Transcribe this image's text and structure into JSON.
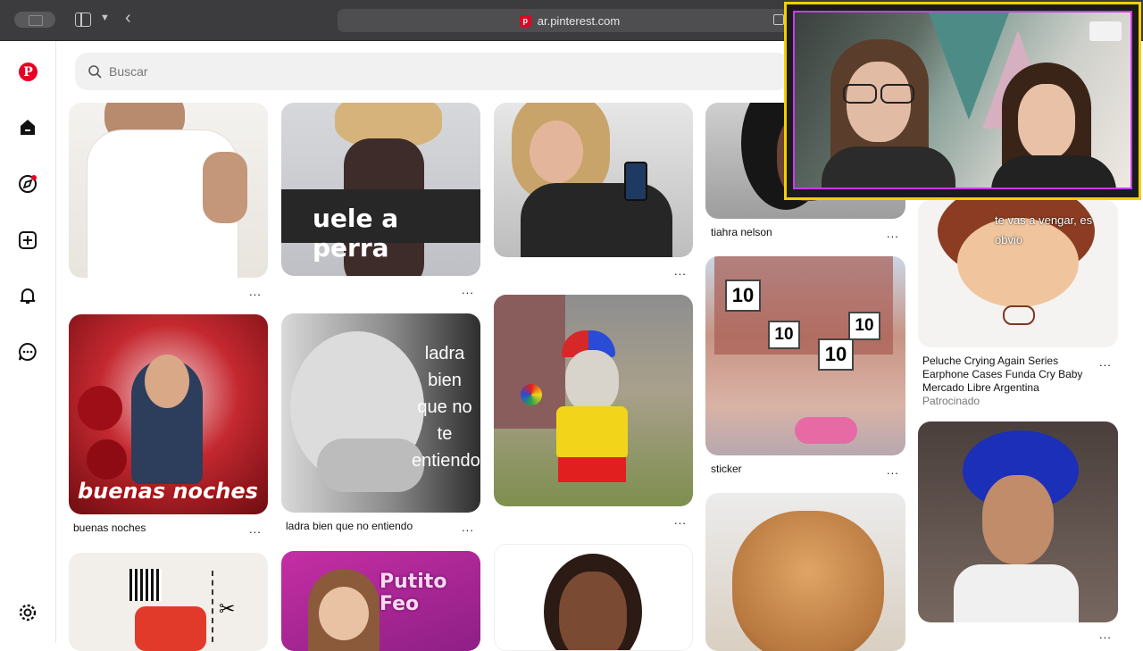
{
  "browser": {
    "url": "ar.pinterest.com",
    "favicon_letter": "p"
  },
  "sidebar": {
    "logo_letter": "P",
    "icons": [
      "home-icon",
      "explore-icon",
      "create-icon",
      "notifications-icon",
      "messages-icon",
      "settings-icon"
    ]
  },
  "search": {
    "placeholder": "Buscar"
  },
  "pins": [
    {
      "caption": "",
      "label": "",
      "dots": "..."
    },
    {
      "caption": "uele a perra",
      "label": "",
      "dots": "..."
    },
    {
      "caption": "",
      "label": "",
      "dots": "..."
    },
    {
      "caption": "",
      "label": "tiahra nelson",
      "dots": "..."
    },
    {
      "caption": "buenas noches",
      "label": "buenas noches",
      "dots": "..."
    },
    {
      "caption": "ladra bien que no te entiendo",
      "label": "ladra bien que no entiendo",
      "dots": "..."
    },
    {
      "caption": "",
      "label": "",
      "dots": "..."
    },
    {
      "caption": "10",
      "label": "sticker",
      "dots": "..."
    },
    {
      "caption": "Putito Feo",
      "label": "",
      "dots": ""
    },
    {
      "caption": "te vas a vengar, es obvio",
      "label": "",
      "dots": ""
    }
  ],
  "sponsored": {
    "title": "Peluche Crying Again Series Earphone Cases Funda Cry Baby",
    "store": "Mercado Libre Argentina",
    "tag": "Patrocinado",
    "dots": "..."
  },
  "last_dots": "...",
  "colors": {
    "brand": "#e60023",
    "webcam_border": "#f2d000",
    "webcam_inner_border": "#c83cf0"
  }
}
